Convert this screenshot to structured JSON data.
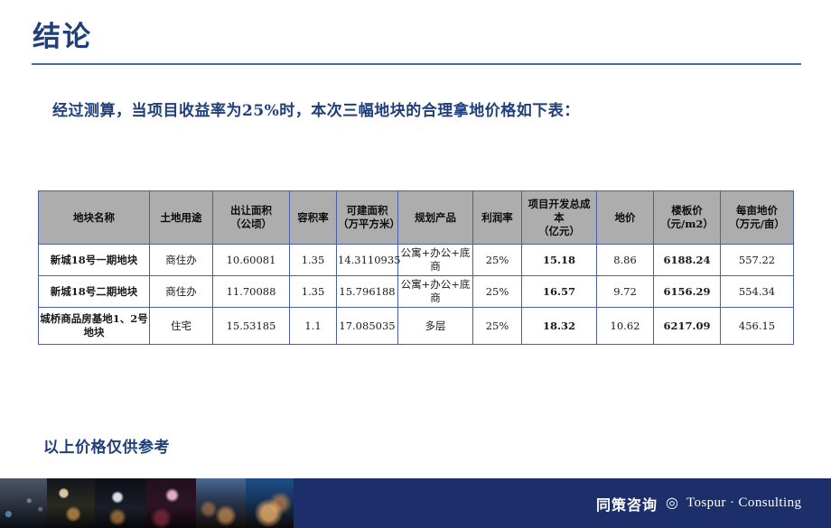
{
  "slide": {
    "title": "结论",
    "subtitle": "经过测算，当项目收益率为25%时，本次三幅地块的合理拿地价格如下表：",
    "footnote": "以上价格仅供参考"
  },
  "table": {
    "headers": [
      {
        "line1": "地块名称",
        "line2": ""
      },
      {
        "line1": "土地用途",
        "line2": ""
      },
      {
        "line1": "出让面积",
        "line2": "（公顷）"
      },
      {
        "line1": "容积率",
        "line2": ""
      },
      {
        "line1": "可建面积",
        "line2": "（万平方米）"
      },
      {
        "line1": "规划产品",
        "line2": ""
      },
      {
        "line1": "利润率",
        "line2": ""
      },
      {
        "line1": "项目开发总成本",
        "line2": "（亿元）"
      },
      {
        "line1": "地价",
        "line2": ""
      },
      {
        "line1": "楼板价",
        "line2": "（元/m2）"
      },
      {
        "line1": "每亩地价",
        "line2": "（万元/亩）"
      }
    ],
    "rows": [
      {
        "name": "新城18号一期地块",
        "use": "商住办",
        "transfer_area": "10.60081",
        "far": "1.35",
        "buildable_area": "14.3110935",
        "product": "公寓+办公+底商",
        "profit_rate": "25%",
        "total_cost": "15.18",
        "land_price": "8.86",
        "floor_price": "6188.24",
        "price_per_mu": "557.22"
      },
      {
        "name": "新城18号二期地块",
        "use": "商住办",
        "transfer_area": "11.70088",
        "far": "1.35",
        "buildable_area": "15.796188",
        "product": "公寓+办公+底商",
        "profit_rate": "25%",
        "total_cost": "16.57",
        "land_price": "9.72",
        "floor_price": "6156.29",
        "price_per_mu": "554.34"
      },
      {
        "name": "城桥商品房基地1、2号地块",
        "use": "住宅",
        "transfer_area": "15.53185",
        "far": "1.1",
        "buildable_area": "17.085035",
        "product": "多层",
        "profit_rate": "25%",
        "total_cost": "18.32",
        "land_price": "10.62",
        "floor_price": "6217.09",
        "price_per_mu": "456.15"
      }
    ]
  },
  "footer": {
    "brand_cn": "同策咨询",
    "brand_mark": "◎",
    "brand_en": "Tospur · Consulting"
  },
  "colors": {
    "title_blue": "#1f3f7a",
    "rule_blue": "#4a6aa5",
    "header_gray": "#adadad",
    "accent_teal": "#3d817b",
    "footer_navy": "#1c2f6b",
    "border_blue": "#4a5fa8"
  }
}
